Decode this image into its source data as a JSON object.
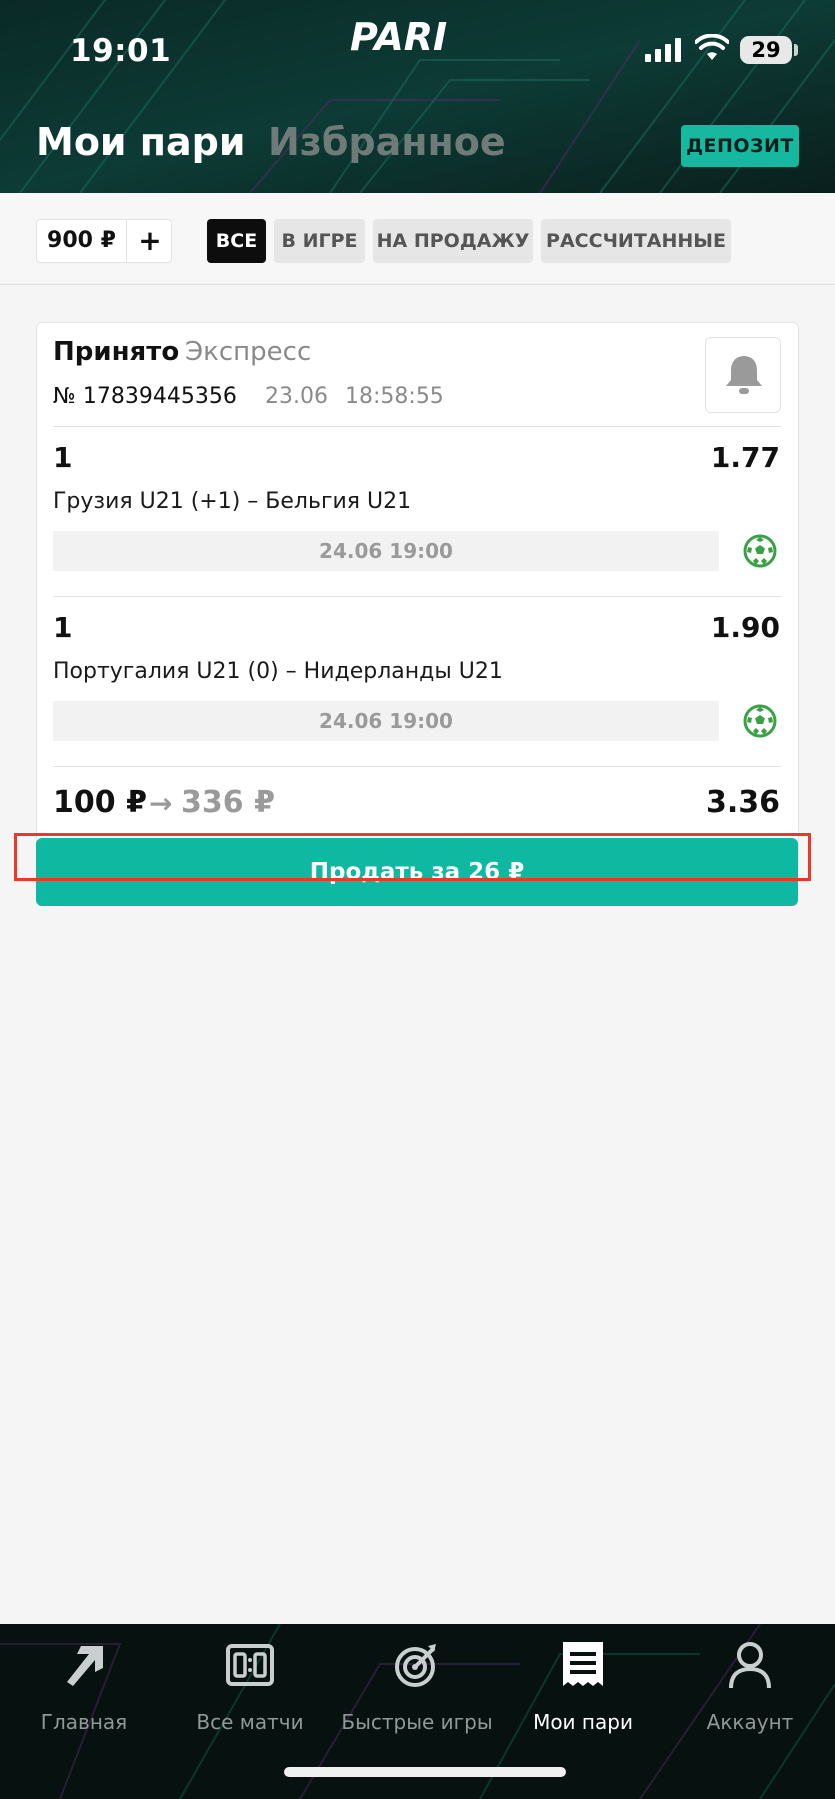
{
  "status_bar": {
    "time": "19:01",
    "battery": "29"
  },
  "brand": {
    "logo_text": "PARI",
    "accent": "#16b9a0"
  },
  "header": {
    "title": "Мои пари",
    "favorites": "Избранное",
    "deposit_label": "ДЕПОЗИТ"
  },
  "filters": {
    "balance": "900 ₽",
    "plus": "+",
    "tabs": [
      {
        "label": "ВСЕ",
        "active": true
      },
      {
        "label": "В ИГРЕ",
        "active": false
      },
      {
        "label": "НА ПРОДАЖУ",
        "active": false
      },
      {
        "label": "РАССЧИТАННЫЕ",
        "active": false
      }
    ]
  },
  "bet": {
    "status": "Принято",
    "type": "Экспресс",
    "number": "№ 17839445356",
    "date": "23.06",
    "time": "18:58:55",
    "selections": [
      {
        "outcome": "1",
        "odds": "1.77",
        "event": "Грузия U21 (+1) – Бельгия U21",
        "start": "24.06 19:00",
        "sport_icon": "soccer-ball-icon"
      },
      {
        "outcome": "1",
        "odds": "1.90",
        "event": "Португалия U21 (0) – Нидерланды U21",
        "start": "24.06 19:00",
        "sport_icon": "soccer-ball-icon"
      }
    ],
    "stake": "100 ₽",
    "arrow": "→",
    "payout": "336 ₽",
    "total_odds": "3.36",
    "sell_label": "Продать за 26 ₽"
  },
  "nav": {
    "items": [
      {
        "label": "Главная",
        "icon": "arrow-icon",
        "active": false
      },
      {
        "label": "Все матчи",
        "icon": "scoreboard-icon",
        "active": false
      },
      {
        "label": "Быстрые игры",
        "icon": "target-icon",
        "active": false
      },
      {
        "label": "Мои пари",
        "icon": "receipt-icon",
        "active": true
      },
      {
        "label": "Аккаунт",
        "icon": "person-icon",
        "active": false
      }
    ]
  }
}
